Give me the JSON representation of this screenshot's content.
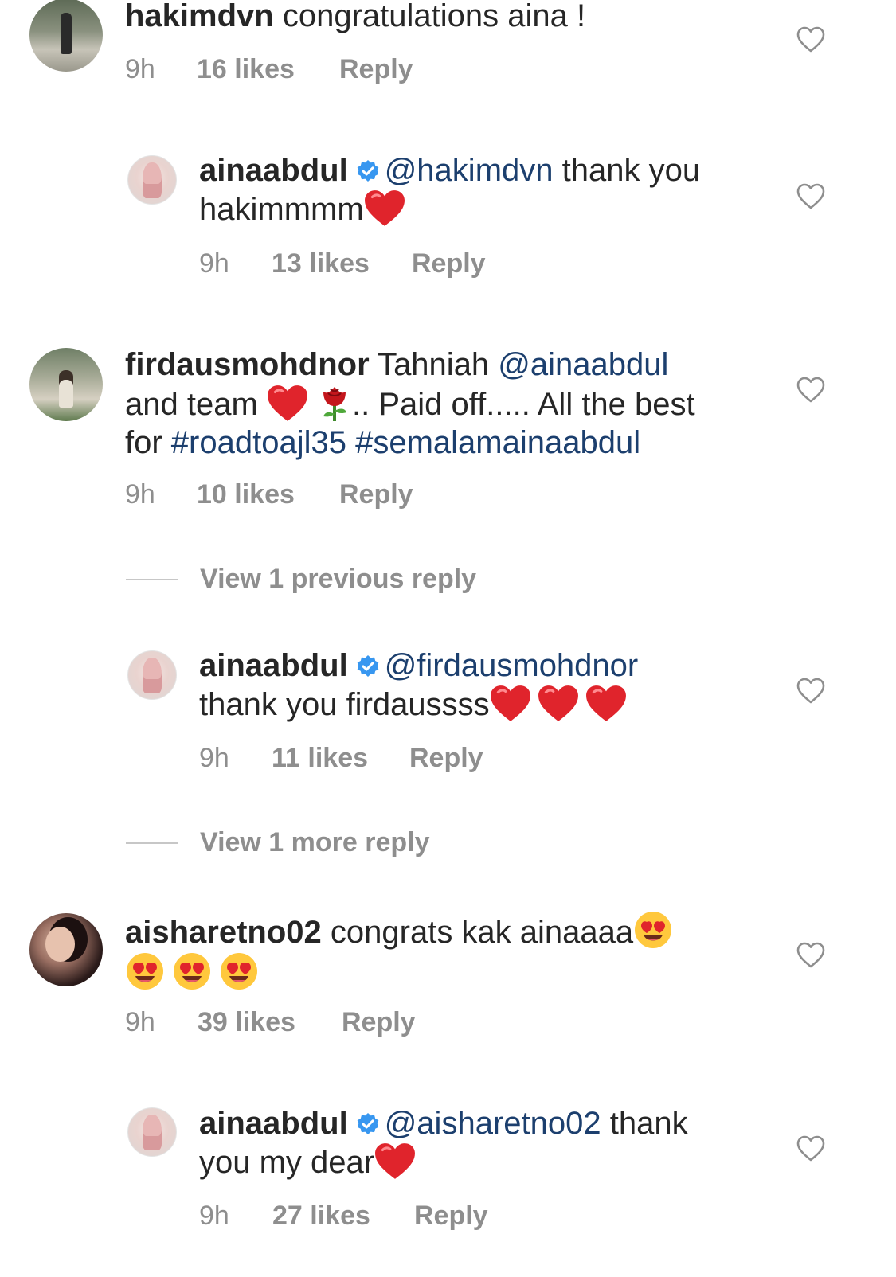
{
  "colors": {
    "text": "#262626",
    "muted": "#8e8e8e",
    "mention": "#1c3f6e",
    "verified_badge": "#3897f0",
    "emoji_heart": "#e0242c"
  },
  "comments": [
    {
      "username": "hakimdvn",
      "body": " congratulations aina !",
      "time": "9h",
      "likes": "16 likes",
      "reply": "Reply"
    },
    {
      "username": "ainaabdul",
      "verified": true,
      "mention": "@hakimdvn",
      "line1_rest": " thank you",
      "line2": "hakimmmm",
      "time": "9h",
      "likes": "13 likes",
      "reply": "Reply"
    },
    {
      "username": "firdausmohdnor",
      "line1_text": " Tahniah ",
      "line1_mention": "@ainaabdul",
      "line2_a": "and team ",
      "line2_b": ".. Paid off..... All the best",
      "line3_a": "for ",
      "line3_tag1": "#roadtoajl35",
      "line3_tag2": "#semalamainaabdul",
      "time": "9h",
      "likes": "10 likes",
      "reply": "Reply"
    },
    {
      "username": "ainaabdul",
      "verified": true,
      "mention": "@firdausmohdnor",
      "line2": "thank you firdaussss",
      "time": "9h",
      "likes": "11 likes",
      "reply": "Reply"
    },
    {
      "username": "aisharetno02",
      "body": " congrats kak ainaaaa",
      "time": "9h",
      "likes": "39 likes",
      "reply": "Reply"
    },
    {
      "username": "ainaabdul",
      "verified": true,
      "mention": "@aisharetno02",
      "line1_rest": " thank",
      "line2": "you my dear",
      "time": "9h",
      "likes": "27 likes",
      "reply": "Reply"
    }
  ],
  "view_replies": [
    "View 1 previous reply",
    "View 1 more reply"
  ],
  "icons": {
    "like": "heart-outline-icon",
    "verified": "verified-badge-icon",
    "emoji_heart": "red-heart-emoji",
    "emoji_rose": "rose-emoji",
    "emoji_hearteyes": "heart-eyes-emoji"
  }
}
